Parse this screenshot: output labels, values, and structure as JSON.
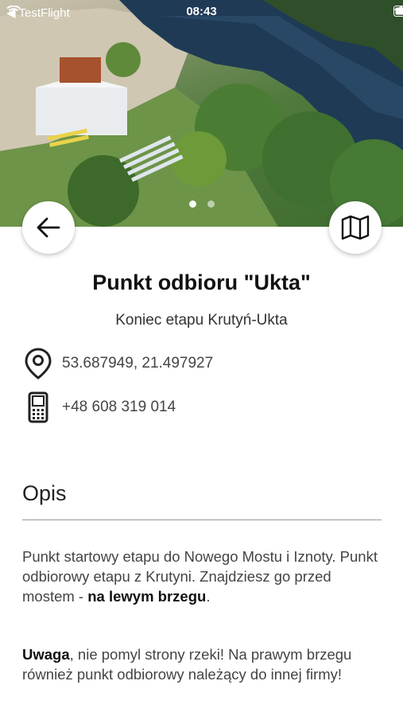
{
  "status_bar": {
    "back_app": "TestFlight",
    "time": "08:43"
  },
  "carousel": {
    "page_count": 2,
    "active_index": 0
  },
  "place": {
    "title": "Punkt odbioru \"Ukta\"",
    "subtitle": "Koniec etapu Krutyń-Ukta",
    "coordinates": "53.687949, 21.497927",
    "phone": "+48 608 319 014"
  },
  "description": {
    "heading": "Opis",
    "p1_text": "Punkt startowy etapu do Nowego Mostu i Iznoty. Punkt odbiorowy etapu z Krutyni. Znajdziesz go przed mostem - ",
    "p1_bold": "na lewym brzegu",
    "p1_end": ".",
    "p2_bold": "Uwaga",
    "p2_text": ", nie pomyl strony rzeki! Na prawym brzegu również punkt odbiorowy należący do innej firmy!"
  },
  "icons": {
    "back": "arrow-left-icon",
    "map": "map-icon",
    "location": "location-pin-icon",
    "phone": "mobile-phone-icon"
  }
}
